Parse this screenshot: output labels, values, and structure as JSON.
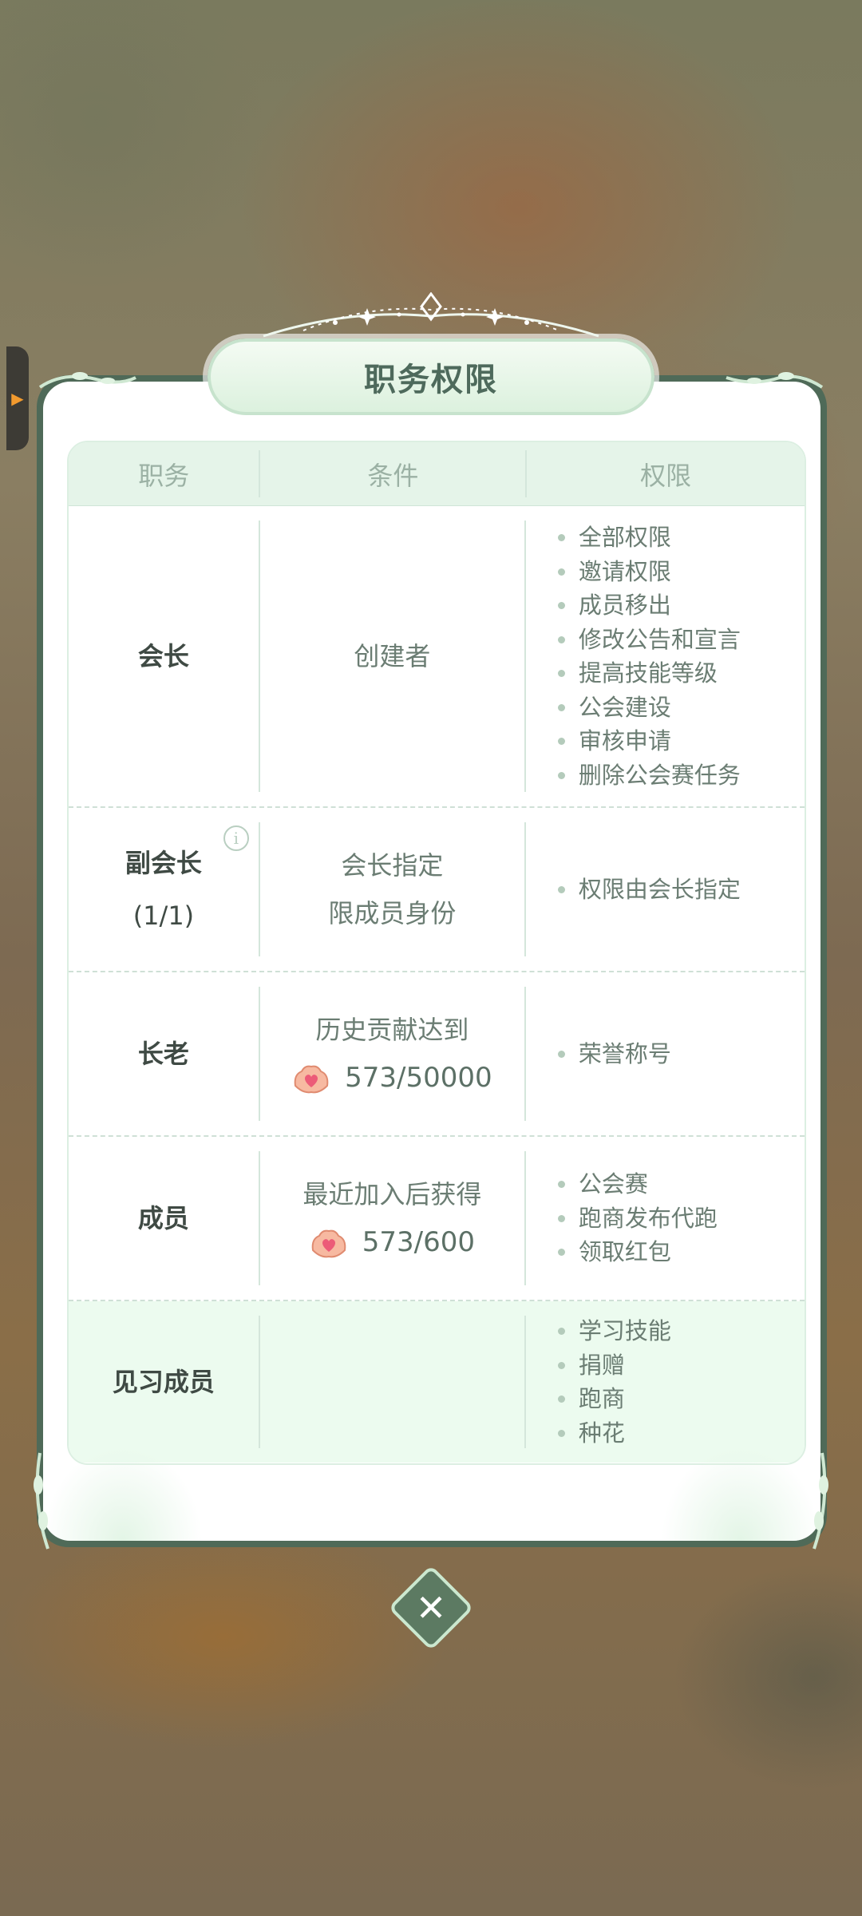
{
  "dialog": {
    "title": "职务权限",
    "headers": [
      "职务",
      "条件",
      "权限"
    ],
    "rows": [
      {
        "role": "会长",
        "condition_lines": [
          "创建者"
        ],
        "permissions": [
          "全部权限",
          "邀请权限",
          "成员移出",
          "修改公告和宣言",
          "提高技能等级",
          "公会建设",
          "审核申请",
          "删除公会赛任务"
        ]
      },
      {
        "role": "副会长",
        "role_count": "(1/1)",
        "has_info_icon": true,
        "condition_lines": [
          "会长指定",
          "限成员身份"
        ],
        "permissions": [
          "权限由会长指定"
        ]
      },
      {
        "role": "长老",
        "condition_lines": [
          "历史贡献达到"
        ],
        "progress": "573/50000",
        "permissions": [
          "荣誉称号"
        ]
      },
      {
        "role": "成员",
        "condition_lines": [
          "最近加入后获得"
        ],
        "progress": "573/600",
        "permissions": [
          "公会赛",
          "跑商发布代跑",
          "领取红包"
        ]
      },
      {
        "role": "见习成员",
        "condition_lines": [],
        "permissions": [
          "学习技能",
          "捐赠",
          "跑商",
          "种花"
        ]
      }
    ]
  },
  "icons": {
    "info": "info-icon",
    "currency": "shell-heart-icon",
    "close": "close-icon",
    "side": "chevron-right-icon"
  },
  "colors": {
    "panel_border": "#4f6a58",
    "header_bg": "#e5f4e9",
    "highlight_row_bg": "#ecfbef",
    "close_button": "#5c7a62"
  }
}
